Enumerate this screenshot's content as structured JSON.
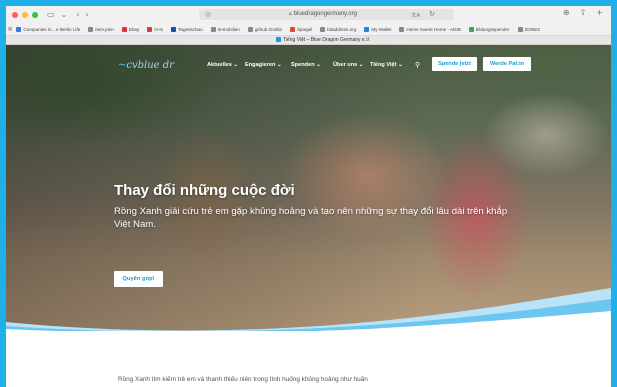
{
  "browser": {
    "url": "bluedragongermany.org",
    "translate_label": "文A",
    "tab_title": "Tiếng Việt – Blue Dragon Germany e.V."
  },
  "favorites": [
    {
      "label": "Companies in…e Berlin Life",
      "color": "#3a7bd5"
    },
    {
      "label": "item.pinn",
      "color": "#888888"
    },
    {
      "label": "Ebay",
      "color": "#e53238"
    },
    {
      "label": "in-lo",
      "color": "#d63b3b"
    },
    {
      "label": "Tagesschau",
      "color": "#1b4f9c"
    },
    {
      "label": "Immobilien",
      "color": "#888888"
    },
    {
      "label": "github Gorilla",
      "color": "#888888"
    },
    {
      "label": "Spiegel",
      "color": "#e2462c"
    },
    {
      "label": "bitaddress.org",
      "color": "#888888"
    },
    {
      "label": "My Wallet",
      "color": "#2a7de1"
    },
    {
      "label": "Home Sweet Home - AIDB",
      "color": "#888888"
    },
    {
      "label": "bildungsspender",
      "color": "#3aa55d"
    },
    {
      "label": "ZONE3",
      "color": "#888888"
    }
  ],
  "site": {
    "logo_mark": "~",
    "logo_text": "cvblue dr",
    "nav": {
      "aktuelles": "Aktuelles ⌄",
      "engagieren": "Engagieren ⌄",
      "spenden": "Spenden ⌄",
      "ueber_uns": "Über uns ⌄",
      "tieng_viet": "Tiếng Việt ⌄"
    },
    "donate_button": "Spende jetzt",
    "sponsor_button": "Werde Pat:in"
  },
  "hero": {
    "title": "Thay đổi những cuộc đời",
    "subtitle": "Rồng Xanh giải cứu trẻ em gặp khủng hoảng và tạo nên những sự thay đổi lâu dài trên khắp Việt Nam.",
    "cta": "Quyên góp!"
  },
  "below": {
    "text": "Rồng Xanh tìm kiếm trẻ em và thanh thiếu niên trong tình huống khủng hoảng như huấn"
  },
  "colors": {
    "brand_blue": "#1a9ad6",
    "frame_blue": "#1fb0e8"
  }
}
